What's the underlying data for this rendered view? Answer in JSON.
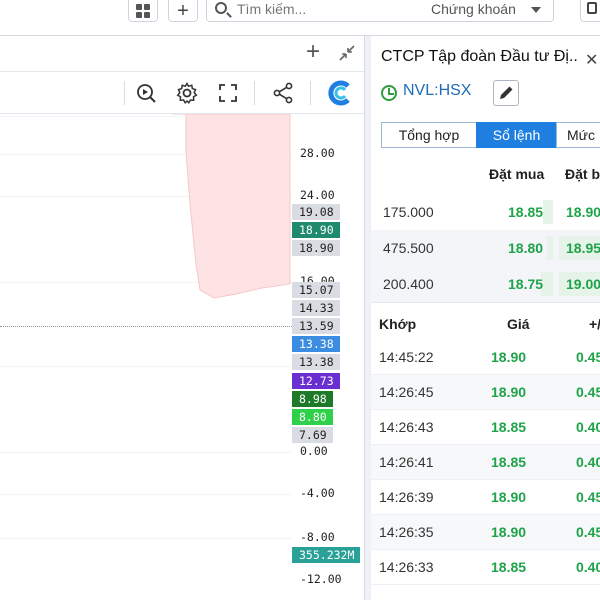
{
  "topbar": {
    "search_placeholder": "Tìm kiếm...",
    "search_scope": "Chứng khoán"
  },
  "chart": {
    "axis_ticks": [
      "28.00",
      "24.00",
      "16.00",
      "0.00",
      "-4.00",
      "-8.00",
      "-12.00"
    ],
    "price_tags": [
      {
        "label": "19.08",
        "color": "#d9dce2"
      },
      {
        "label": "18.90",
        "color": "#1f8a6e"
      },
      {
        "label": "18.90",
        "color": "#d9dce2"
      },
      {
        "label": "15.07",
        "color": "#d9dce2"
      },
      {
        "label": "14.33",
        "color": "#d9dce2"
      },
      {
        "label": "13.59",
        "color": "#d9dce2"
      },
      {
        "label": "13.38",
        "color": "#3a8de0"
      },
      {
        "label": "13.38",
        "color": "#d9dce2"
      },
      {
        "label": "12.73",
        "color": "#6a2fd1"
      },
      {
        "label": "8.98",
        "color": "#1e7a2a"
      },
      {
        "label": "8.80",
        "color": "#2fd14a"
      },
      {
        "label": "7.69",
        "color": "#d9dce2"
      },
      {
        "label": "355.232M",
        "color": "#2aa197"
      }
    ]
  },
  "panel": {
    "stock_name": "CTCP Tập đoàn Đầu tư Đị",
    "stock_name_ellipsis": "..",
    "ticker": "NVL:HSX",
    "tabs": [
      "Tổng hợp",
      "Sổ lệnh",
      "Mức"
    ],
    "orderbook": {
      "col_bid": "Đặt mua",
      "col_ask": "Đặt b",
      "rows": [
        {
          "volume": "175.000",
          "bid": "18.85",
          "ask": "18.90"
        },
        {
          "volume": "475.500",
          "bid": "18.80",
          "ask": "18.95"
        },
        {
          "volume": "200.400",
          "bid": "18.75",
          "ask": "19.00"
        }
      ]
    },
    "trades": {
      "col_time": "Khớp",
      "col_price": "Giá",
      "col_change": "+/",
      "rows": [
        {
          "time": "14:45:22",
          "price": "18.90",
          "change": "0.45"
        },
        {
          "time": "14:26:45",
          "price": "18.90",
          "change": "0.45"
        },
        {
          "time": "14:26:43",
          "price": "18.85",
          "change": "0.40"
        },
        {
          "time": "14:26:41",
          "price": "18.85",
          "change": "0.40"
        },
        {
          "time": "14:26:39",
          "price": "18.90",
          "change": "0.45"
        },
        {
          "time": "14:26:35",
          "price": "18.90",
          "change": "0.45"
        },
        {
          "time": "14:26:33",
          "price": "18.85",
          "change": "0.40"
        }
      ]
    }
  },
  "colors": {
    "up_green": "#1fa34a",
    "accent_blue": "#1f7fe0",
    "ticker_blue": "#1e6bb8",
    "area_pink": "#fde3e3"
  },
  "icons": [
    "grid-icon",
    "plus-icon",
    "search-icon",
    "chevron-down-icon",
    "chat-icon",
    "collapse-icon",
    "quick-compare-icon",
    "gear-icon",
    "fullscreen-icon",
    "share-icon",
    "brand-logo-icon",
    "clock-icon",
    "pencil-icon"
  ]
}
